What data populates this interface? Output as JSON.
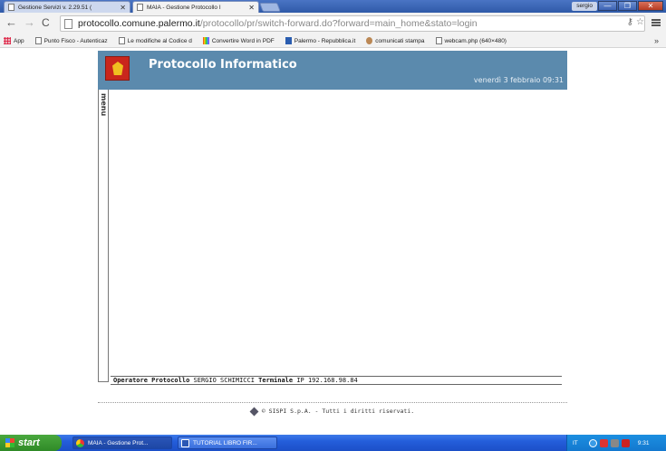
{
  "browser": {
    "tabs": [
      {
        "label": "Gestione Servizi v. 2.29.51 ("
      },
      {
        "label": "MAIA - Gestione Protocollo I"
      }
    ],
    "user": "sergio",
    "window_buttons": {
      "minimize": "—",
      "maximize": "❐",
      "close": "✕"
    },
    "address": {
      "host": "protocollo.comune.palermo.it",
      "path": "/protocollo/pr/switch-forward.do?forward=main_home&stato=login"
    },
    "bookmarks": [
      {
        "label": "App",
        "icon": "apps-icon"
      },
      {
        "label": "Punto Fisco - Autenticaz",
        "icon": "page-icon"
      },
      {
        "label": "Le modifiche al Codice d",
        "icon": "page-icon"
      },
      {
        "label": "Convertire Word in PDF",
        "icon": "color-icon"
      },
      {
        "label": "Palermo - Repubblica.it",
        "icon": "repubblica-icon"
      },
      {
        "label": "comunicati stampa",
        "icon": "round-icon"
      },
      {
        "label": "webcam.php (640×480)",
        "icon": "page-icon"
      }
    ],
    "bookmarks_overflow": "»"
  },
  "page": {
    "title": "Protocollo Informatico",
    "datetime": "venerdì 3 febbraio 09:31",
    "menu_label": "menu",
    "operator_label": "Operatore Protocollo",
    "operator_name": "SERGIO SCHIMICCI",
    "terminal_label": "Terminale",
    "terminal_value": "IP 192.168.98.84",
    "footer": "© SISPI S.p.A. - Tutti i diritti riservati."
  },
  "taskbar": {
    "start": "start",
    "items": [
      {
        "label": "MAIA - Gestione Prot..."
      },
      {
        "label": "TUTORIAL LIBRO FIR..."
      }
    ],
    "language": "IT",
    "clock": "9:31"
  }
}
